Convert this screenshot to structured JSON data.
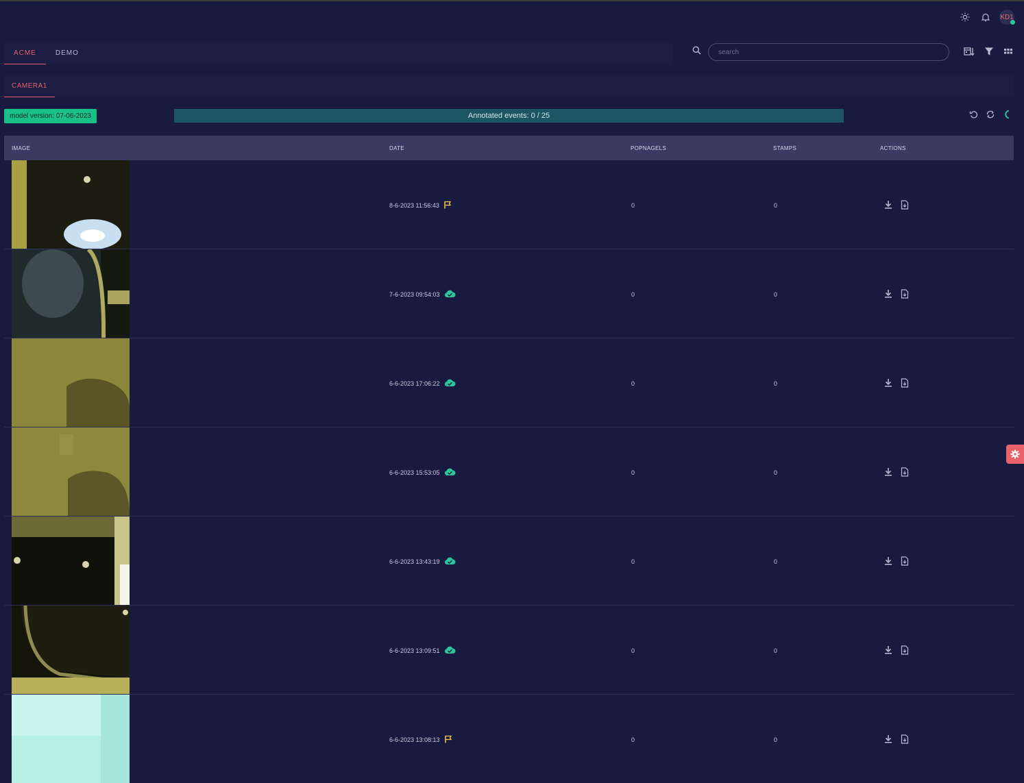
{
  "header": {
    "avatar_initials": "KD1",
    "icons": [
      "sun-icon",
      "bell-icon"
    ]
  },
  "tabs": [
    {
      "label": "ACME",
      "active": true
    },
    {
      "label": "DEMO",
      "active": false
    }
  ],
  "search": {
    "placeholder": "search",
    "value": ""
  },
  "tools": [
    "calendar-sort-icon",
    "filter-icon",
    "grid-icon"
  ],
  "subtabs": [
    {
      "label": "CAMERA1",
      "active": true
    }
  ],
  "model_badge": "model version: 07-06-2023",
  "progress": {
    "label": "Annotated events: 0 / 25",
    "annotated": 0,
    "total": 25
  },
  "colors": {
    "accent": "#e8646a",
    "success": "#29c79b",
    "flag": "#f2c94c",
    "background": "#181a3f"
  },
  "table": {
    "columns": [
      "IMAGE",
      "DATE",
      "POPNAGELS",
      "STAMPS",
      "ACTIONS"
    ],
    "rows": [
      {
        "date": "8-6-2023 11:56:43",
        "status": "flag",
        "popnagels": "0",
        "stamps": "0"
      },
      {
        "date": "7-6-2023 09:54:03",
        "status": "cloud-check",
        "popnagels": "0",
        "stamps": "0"
      },
      {
        "date": "6-6-2023 17:06:22",
        "status": "cloud-check",
        "popnagels": "0",
        "stamps": "0"
      },
      {
        "date": "6-6-2023 15:53:05",
        "status": "cloud-check",
        "popnagels": "0",
        "stamps": "0"
      },
      {
        "date": "6-6-2023 13:43:19",
        "status": "cloud-check",
        "popnagels": "0",
        "stamps": "0"
      },
      {
        "date": "6-6-2023 13:09:51",
        "status": "cloud-check",
        "popnagels": "0",
        "stamps": "0"
      },
      {
        "date": "6-6-2023 13:08:13",
        "status": "flag",
        "popnagels": "0",
        "stamps": "0"
      }
    ]
  }
}
